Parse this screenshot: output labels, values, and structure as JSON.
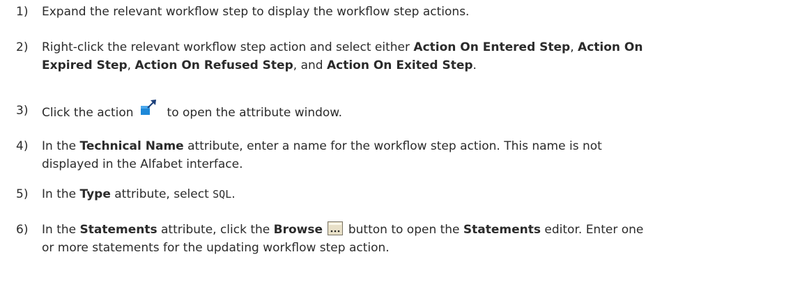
{
  "steps": [
    {
      "num": "1)",
      "line1": "Expand the relevant workflow step to display the workflow step actions."
    },
    {
      "num": "2)",
      "t1": "Right-click the relevant workflow step action and select either ",
      "b1": "Action On Entered Step",
      "t2": ", ",
      "b2a": "Action On",
      "b2b": "Expired Step",
      "t3": ", ",
      "b3": "Action On Refused Step",
      "t4": ", and ",
      "b4": "Action On Exited Step",
      "t5": "."
    },
    {
      "num": "3)",
      "t1": "Click the action",
      "icon": "open-attribute-window-icon",
      "t2": "to open the attribute window."
    },
    {
      "num": "4)",
      "t1": "In the ",
      "b1": "Technical Name",
      "t2": " attribute, enter a name for the workflow step action. This name is not",
      "t3": "displayed in the Alfabet interface."
    },
    {
      "num": "5)",
      "t1": "In the ",
      "b1": "Type",
      "t2": " attribute, select ",
      "code": "SQL",
      "t3": "."
    },
    {
      "num": "6)",
      "t1": "In the ",
      "b1": "Statements",
      "t2": " attribute, click the ",
      "b2": "Browse",
      "icon": "browse-icon",
      "t3": " button to open the ",
      "b3": "Statements",
      "t4": " editor. Enter one",
      "t5": "or more statements for the updating workflow step action."
    }
  ]
}
